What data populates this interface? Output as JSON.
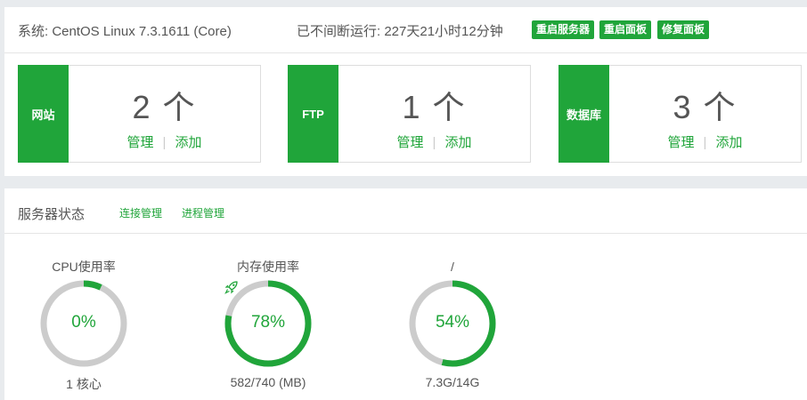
{
  "system": {
    "os_label": "系统: CentOS Linux 7.3.1611 (Core)",
    "uptime_label": "已不间断运行: 227天21小时12分钟",
    "buttons": [
      "重启服务器",
      "重启面板",
      "修复面板"
    ]
  },
  "cards": [
    {
      "tag": "网站",
      "count": "2 个",
      "manage": "管理",
      "separator": "|",
      "add": "添加"
    },
    {
      "tag": "FTP",
      "count": "1 个",
      "manage": "管理",
      "separator": "|",
      "add": "添加"
    },
    {
      "tag": "数据库",
      "count": "3 个",
      "manage": "管理",
      "separator": "|",
      "add": "添加"
    }
  ],
  "status": {
    "title": "服务器状态",
    "links": [
      "连接管理",
      "进程管理"
    ]
  },
  "gauges": [
    {
      "title": "CPU使用率",
      "value": "0%",
      "fraction": 0.07,
      "footer": "1 核心",
      "icon": ""
    },
    {
      "title": "内存使用率",
      "value": "78%",
      "fraction": 0.78,
      "footer": "582/740 (MB)",
      "icon": "rocket-icon"
    },
    {
      "title": "/",
      "value": "54%",
      "fraction": 0.54,
      "footer": "7.3G/14G",
      "icon": ""
    }
  ],
  "colors": {
    "accent": "#20a53a",
    "track": "#cccccc"
  }
}
